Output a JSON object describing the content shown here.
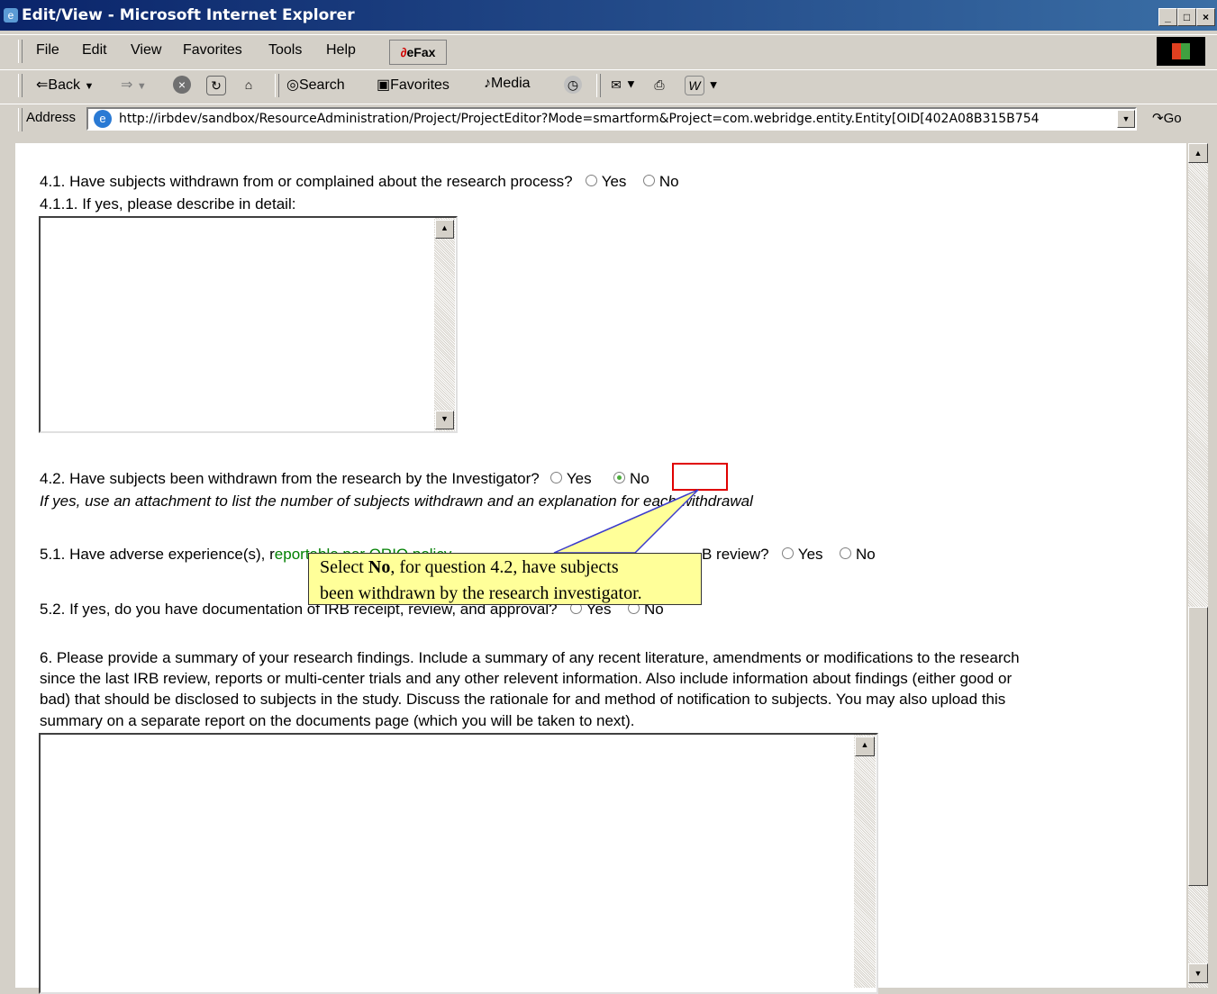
{
  "window": {
    "title": "Edit/View - Microsoft Internet Explorer",
    "controls": [
      "_",
      "□",
      "×"
    ]
  },
  "menu": {
    "items": [
      "File",
      "Edit",
      "View",
      "Favorites",
      "Tools",
      "Help"
    ],
    "efax": "eFax"
  },
  "toolbar": {
    "back": "Back",
    "search": "Search",
    "favorites": "Favorites",
    "media": "Media"
  },
  "address": {
    "label": "Address",
    "url": "http://irbdev/sandbox/ResourceAdministration/Project/ProjectEditor?Mode=smartform&Project=com.webridge.entity.Entity[OID[402A08B315B754",
    "go": "Go"
  },
  "form": {
    "q41": {
      "label": "4.1.  Have subjects withdrawn from or complained about the research process?",
      "yes": "Yes",
      "no": "No"
    },
    "q411": {
      "label": "4.1.1. If yes, please describe in detail:"
    },
    "q42": {
      "label": "4.2.  Have subjects been withdrawn from the research by the Investigator?",
      "yes": "Yes",
      "no": "No",
      "selected": "No"
    },
    "q42_note": "If yes, use an attachment to list the number of subjects withdrawn and an explanation for each withdrawal",
    "q51": {
      "label_start": "5.1.  Have adverse experience(s), r",
      "link": "eportable per ORIO policy",
      "label_end": "B review?",
      "yes": "Yes",
      "no": "No"
    },
    "q52": {
      "label": "5.2.  If yes, do you have documentation of IRB receipt, review, and approval?",
      "yes": "Yes",
      "no": "No"
    },
    "q6": {
      "line1": "6.  Please provide a summary of your research findings. Include a summary of any recent literature, amendments or modifications to the research",
      "line2": "since the last IRB review, reports or multi-center trials and any other relevent information.  Also include information about findings (either good or",
      "line3": "bad) that should be disclosed to subjects in the study.  Discuss the rationale for and method of notification to subjects.  You may also upload this",
      "line4": "summary on a separate report on the documents page (which you will be taken to next)."
    }
  },
  "callout": {
    "pre": "Select ",
    "bold": "No",
    "post": ", for question 4.2, have subjects",
    "line2": "been withdrawn by the research investigator."
  },
  "colors": {
    "titlebar_start": "#0a246a",
    "titlebar_end": "#3a6ea5",
    "highlight": "#e00000",
    "callout": "#ffff99",
    "link": "#008000"
  }
}
